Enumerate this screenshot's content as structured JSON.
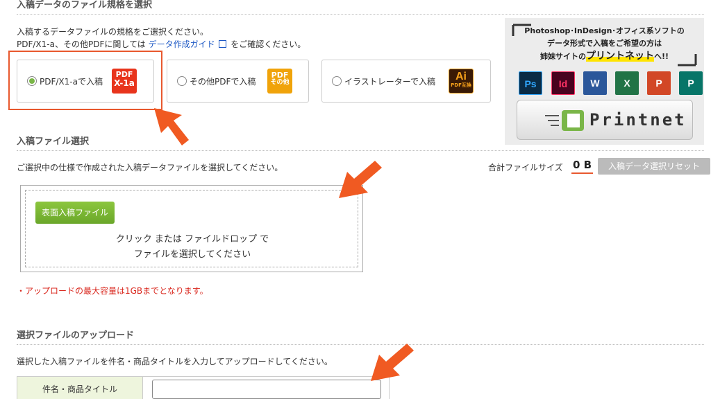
{
  "section_format": {
    "title": "入稿データのファイル規格を選択",
    "intro_line1": "入稿するデータファイルの規格をご選択ください。",
    "intro_line2_prefix": "PDF/X1-a、その他PDFに関しては",
    "guide_link": "データ作成ガイド",
    "intro_line2_suffix": "をご確認ください。",
    "options": [
      {
        "label": "PDF/X1-aで入稿",
        "selected": true,
        "badge_top": "PDF",
        "badge_bottom": "X-1a",
        "badge_color": "#e8341c"
      },
      {
        "label": "その他PDFで入稿",
        "selected": false,
        "badge_top": "PDF",
        "badge_bottom": "その他",
        "badge_color": "#f0a30a"
      },
      {
        "label": "イラストレーターで入稿",
        "selected": false,
        "badge_top": "Ai",
        "badge_bottom": "PDF互換",
        "badge_color": "#3a1a05"
      }
    ]
  },
  "promo": {
    "line1": "Photoshop･InDesign･オフィス系ソフトの",
    "line2": "データ形式で入稿をご希望の方は",
    "line3_prefix": "姉妹サイトの",
    "line3_highlight": "プリントネット",
    "line3_suffix": "へ!!",
    "apps": [
      {
        "icon": "photoshop-icon",
        "text": "Ps",
        "color": "#0a2b45",
        "fg": "#31a8ff"
      },
      {
        "icon": "indesign-icon",
        "text": "Id",
        "color": "#49021f",
        "fg": "#ff3366"
      },
      {
        "icon": "word-icon",
        "text": "W",
        "color": "#2b579a",
        "fg": "#ffffff"
      },
      {
        "icon": "excel-icon",
        "text": "X",
        "color": "#217346",
        "fg": "#ffffff"
      },
      {
        "icon": "powerpoint-icon",
        "text": "P",
        "color": "#d24726",
        "fg": "#ffffff"
      },
      {
        "icon": "publisher-icon",
        "text": "P",
        "color": "#077568",
        "fg": "#ffffff"
      }
    ],
    "button_label": "Printnet"
  },
  "section_file": {
    "title": "入稿ファイル選択",
    "intro": "ご選択中の仕様で作成された入稿データファイルを選択してください。",
    "total_size_label": "合計ファイルサイズ",
    "total_size_value": "0 B",
    "reset_button": "入稿データ選択リセット",
    "upload_button": "表面入稿ファイル",
    "drop_line1": "クリック または ファイルドロップ で",
    "drop_line2": "ファイルを選択してください",
    "warning": "・アップロードの最大容量は1GBまでとなります。"
  },
  "section_upload": {
    "title": "選択ファイルのアップロード",
    "intro": "選択した入稿ファイルを件名・商品タイトルを入力してアップロードしてください。",
    "field_label": "件名・商品タイトル",
    "field_value": "",
    "field_placeholder": ""
  },
  "colors": {
    "accent_orange": "#e8582e",
    "green": "#7ab648",
    "warning_red": "#d9261c"
  }
}
